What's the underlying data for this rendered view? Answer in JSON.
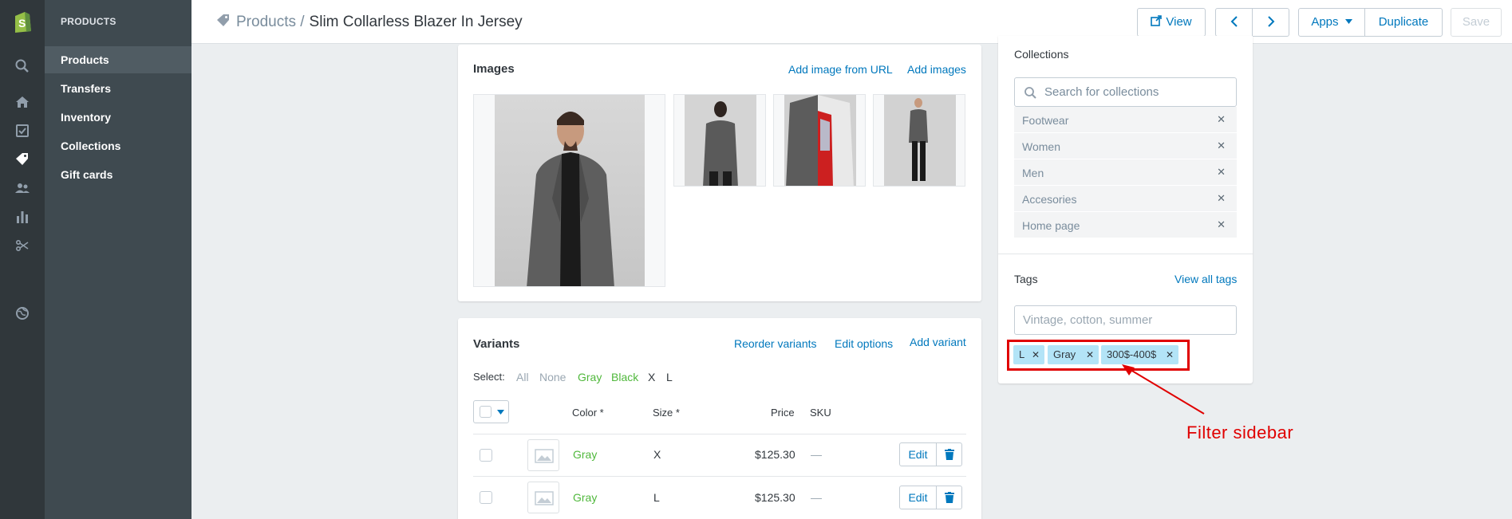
{
  "sidebar": {
    "heading": "PRODUCTS",
    "items": [
      {
        "label": "Products",
        "active": true
      },
      {
        "label": "Transfers"
      },
      {
        "label": "Inventory"
      },
      {
        "label": "Collections"
      },
      {
        "label": "Gift cards"
      }
    ]
  },
  "header": {
    "breadcrumb_root": "Products",
    "breadcrumb_sep": "/",
    "title": "Slim Collarless Blazer In Jersey",
    "view_label": "View",
    "apps_label": "Apps",
    "duplicate_label": "Duplicate",
    "save_label": "Save"
  },
  "images": {
    "title": "Images",
    "add_from_url": "Add image from URL",
    "add_images": "Add images"
  },
  "variants": {
    "title": "Variants",
    "reorder": "Reorder variants",
    "edit_options": "Edit options",
    "add_variant": "Add variant",
    "select_label": "Select:",
    "select_options": [
      "All",
      "None",
      "Gray",
      "Black",
      "X",
      "L"
    ],
    "columns": {
      "color": "Color *",
      "size": "Size *",
      "price": "Price",
      "sku": "SKU"
    },
    "edit_label": "Edit",
    "rows": [
      {
        "color": "Gray",
        "size": "X",
        "price": "$125.30",
        "sku": "—"
      },
      {
        "color": "Gray",
        "size": "L",
        "price": "$125.30",
        "sku": "—"
      }
    ]
  },
  "collections": {
    "title": "Collections",
    "search_placeholder": "Search for collections",
    "items": [
      "Footwear",
      "Women",
      "Men",
      "Accesories",
      "Home page"
    ],
    "remove_glyph": "✕"
  },
  "tags": {
    "title": "Tags",
    "view_all": "View all tags",
    "placeholder": "Vintage, cotton, summer",
    "chips": [
      "L",
      "Gray",
      "300$-400$"
    ],
    "remove_glyph": "✕"
  },
  "annotation": {
    "label": "Filter sidebar",
    "color": "#e00000"
  },
  "colors": {
    "link": "#0078bd",
    "variant_color": "#50b83c",
    "tag_chip": "#b3e4f7",
    "nav": "#30373b"
  }
}
